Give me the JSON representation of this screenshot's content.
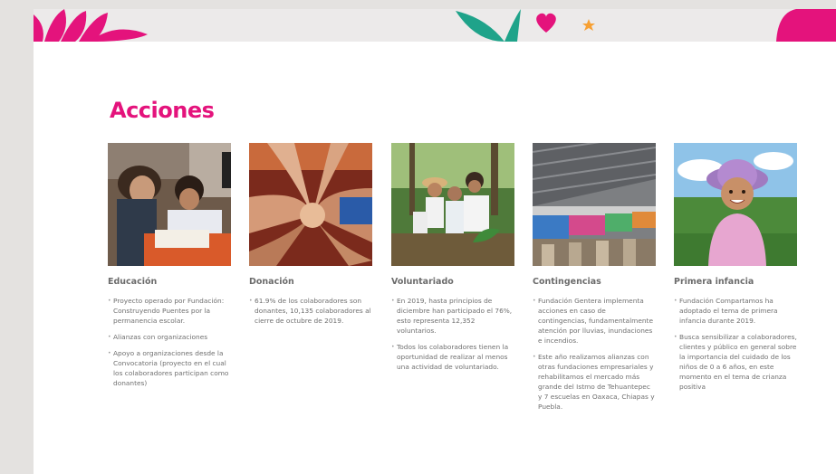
{
  "title": "Acciones",
  "columns": [
    {
      "heading": "Educación",
      "photo_icon": "education-photo",
      "bullets": [
        "Proyecto operado por Fundación: Construyendo Puentes por la permanencia escolar.",
        "Alianzas con organizaciones",
        "Apoyo a organizaciones desde la Convocatoria (proyecto en el cual los colaboradores participan como donantes)"
      ]
    },
    {
      "heading": "Donación",
      "photo_icon": "hands-together-photo",
      "bullets": [
        "61.9% de los colaboradores son donantes, 10,135 colaboradores al cierre de octubre de 2019."
      ]
    },
    {
      "heading": "Voluntariado",
      "photo_icon": "volunteers-photo",
      "bullets": [
        "En 2019, hasta principios de diciembre han participado el 76%, esto representa 12,352 voluntarios.",
        "Todos los colaboradores tienen la oportunidad de realizar al menos una actividad de voluntariado."
      ]
    },
    {
      "heading": "Contingencias",
      "photo_icon": "market-photo",
      "bullets": [
        "Fundación Gentera implementa acciones en caso de contingencias, fundamentalmente atención por lluvias, inundaciones e incendios.",
        "Este año realizamos alianzas con otras fundaciones empresariales y rehabilitamos el mercado más grande del Istmo de Tehuantepec y 7 escuelas en Oaxaca, Chiapas y Puebla."
      ]
    },
    {
      "heading": "Primera infancia",
      "photo_icon": "child-photo",
      "bullets": [
        "Fundación Compartamos ha adoptado el tema de primera infancia durante 2019.",
        "Busca sensibilizar a colaboradores, clientes y público en general sobre la importancia del cuidado de los niños de 0 a 6 años, en este momento en el tema de crianza positiva"
      ]
    }
  ],
  "colors": {
    "accent": "#e4137c",
    "teal": "#1fa38a",
    "orange": "#f7a033",
    "text": "#6f6f6f"
  }
}
